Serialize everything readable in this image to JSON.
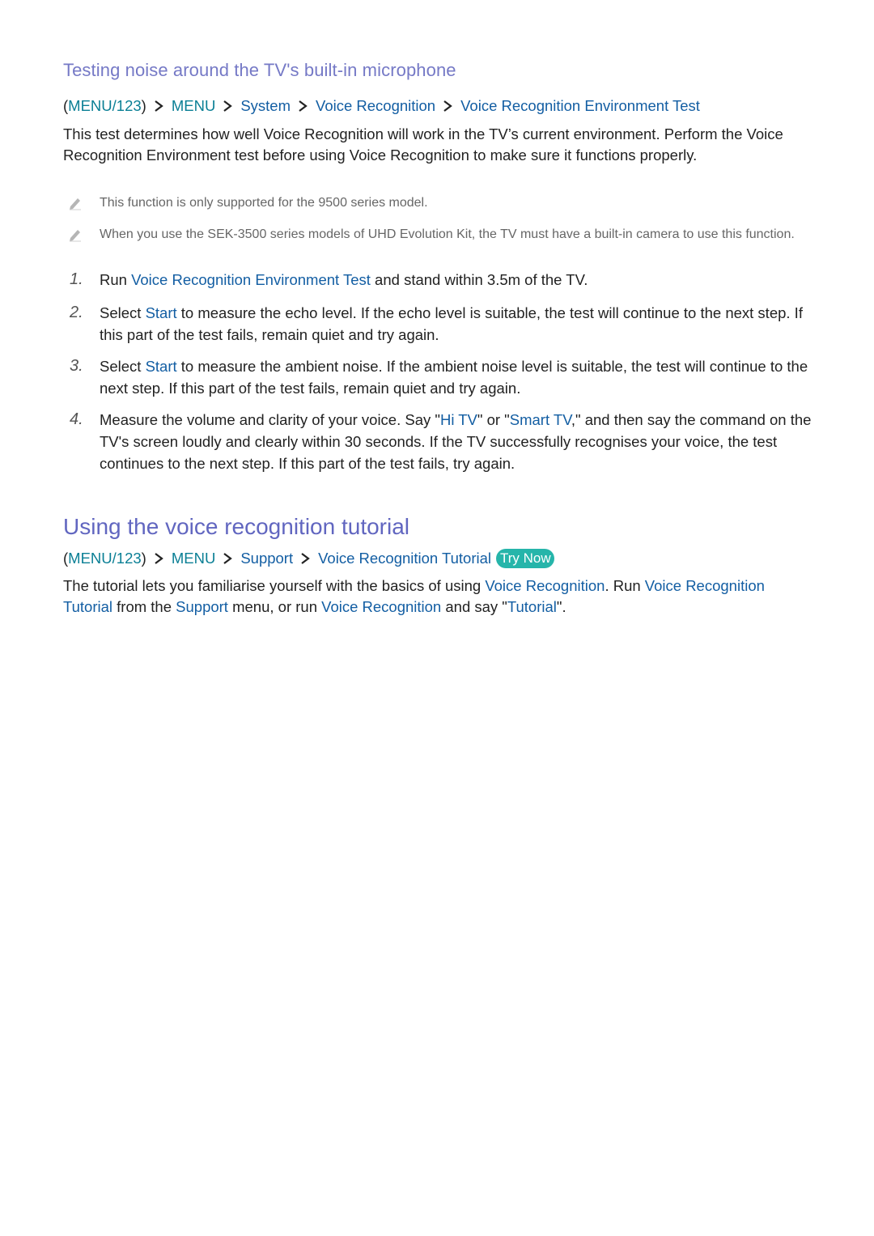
{
  "section1": {
    "subheading": "Testing noise around the TV's built-in microphone",
    "breadcrumb": {
      "prefix": "MENU/123",
      "items": [
        "MENU",
        "System",
        "Voice Recognition",
        "Voice Recognition Environment Test"
      ]
    },
    "intro": "This test determines how well Voice Recognition will work in the TV’s current environment. Perform the Voice Recognition Environment test before using Voice Recognition to make sure it functions properly.",
    "notes": [
      "This function is only supported for the 9500 series model.",
      "When you use the SEK-3500 series models of UHD Evolution Kit, the TV must have a built-in camera to use this function."
    ],
    "steps": [
      {
        "number": "1.",
        "parts": [
          {
            "text": "Run "
          },
          {
            "text": "Voice Recognition Environment Test",
            "link": true
          },
          {
            "text": " and stand within 3.5m of the TV."
          }
        ]
      },
      {
        "number": "2.",
        "parts": [
          {
            "text": "Select "
          },
          {
            "text": "Start",
            "link": true
          },
          {
            "text": " to measure the echo level. If the echo level is suitable, the test will continue to the next step. If this part of the test fails, remain quiet and try again."
          }
        ]
      },
      {
        "number": "3.",
        "parts": [
          {
            "text": "Select "
          },
          {
            "text": "Start",
            "link": true
          },
          {
            "text": " to measure the ambient noise. If the ambient noise level is suitable, the test will continue to the next step. If this part of the test fails, remain quiet and try again."
          }
        ]
      },
      {
        "number": "4.",
        "parts": [
          {
            "text": "Measure the volume and clarity of your voice. Say \""
          },
          {
            "text": "Hi TV",
            "link": true
          },
          {
            "text": "\" or \""
          },
          {
            "text": "Smart TV",
            "link": true
          },
          {
            "text": ",\" and then say the command on the TV's screen loudly and clearly within 30 seconds. If the TV successfully recognises your voice, the test continues to the next step. If this part of the test fails, try again."
          }
        ]
      }
    ]
  },
  "section2": {
    "heading": "Using the voice recognition tutorial",
    "breadcrumb": {
      "prefix": "MENU/123",
      "items": [
        "MENU",
        "Support",
        "Voice Recognition Tutorial"
      ],
      "try_now": "Try Now"
    },
    "body": [
      {
        "text": "The tutorial lets you familiarise yourself with the basics of using "
      },
      {
        "text": "Voice Recognition",
        "link": true
      },
      {
        "text": ". Run "
      },
      {
        "text": "Voice Recognition Tutorial",
        "link": true
      },
      {
        "text": " from the "
      },
      {
        "text": "Support",
        "link": true
      },
      {
        "text": " menu, or run "
      },
      {
        "text": "Voice Recognition",
        "link": true
      },
      {
        "text": " and say \""
      },
      {
        "text": "Tutorial",
        "link": true
      },
      {
        "text": "\"."
      }
    ]
  },
  "colors": {
    "heading": "#6166c0",
    "subheading": "#7579c6",
    "menu_teal": "#0a7f95",
    "link_blue": "#135ea3",
    "try_now_bg": "#26b5aa",
    "note_text": "#666666",
    "body_text": "#222222"
  },
  "icons": {
    "breadcrumb_separator": "chevron-right-icon",
    "note": "pencil-icon"
  }
}
